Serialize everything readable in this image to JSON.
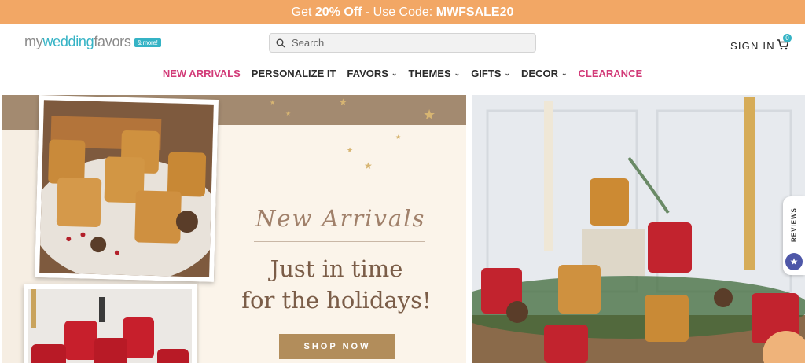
{
  "promo": {
    "prefix": "Get ",
    "highlight": "20% Off",
    "middle": " - Use Code: ",
    "code": "MWFSALE20"
  },
  "logo": {
    "part1": "my",
    "part2": "wedding",
    "part3": "favors",
    "tag": "& more!"
  },
  "search": {
    "placeholder": "Search"
  },
  "header": {
    "signin": "SIGN IN",
    "cart_count": "0"
  },
  "nav": [
    {
      "label": "NEW ARRIVALS"
    },
    {
      "label": "PERSONALIZE IT"
    },
    {
      "label": "FAVORS"
    },
    {
      "label": "THEMES"
    },
    {
      "label": "GIFTS"
    },
    {
      "label": "DECOR"
    },
    {
      "label": "CLEARANCE"
    }
  ],
  "hero": {
    "script_title": "New Arrivals",
    "line1": "Just in time",
    "line2": "for the holidays!",
    "cta": "SHOP NOW"
  },
  "reviews": {
    "label": "REVIEWS"
  },
  "colors": {
    "promo_bg": "#f2a765",
    "accent_teal": "#35b3c5",
    "accent_pink": "#d23b78",
    "cta_bg": "#b28d5b"
  },
  "icons": [
    "search-icon",
    "cart-icon",
    "chevron-down-icon",
    "star-icon"
  ]
}
